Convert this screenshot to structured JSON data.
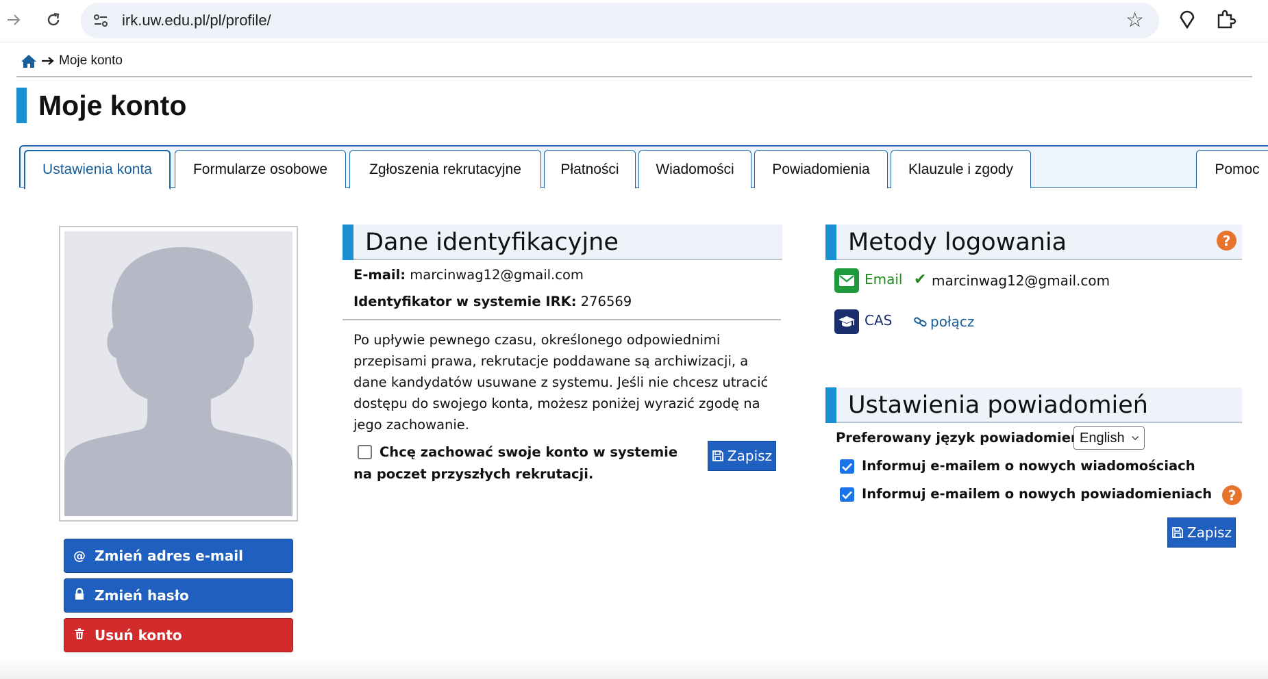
{
  "browser": {
    "url": "irk.uw.edu.pl/pl/profile/"
  },
  "breadcrumb": {
    "current": "Moje konto"
  },
  "page": {
    "title": "Moje konto"
  },
  "tabs": [
    {
      "label": "Ustawienia konta",
      "active": true
    },
    {
      "label": "Formularze osobowe"
    },
    {
      "label": "Zgłoszenia rekrutacyjne"
    },
    {
      "label": "Płatności"
    },
    {
      "label": "Wiadomości"
    },
    {
      "label": "Powiadomienia"
    },
    {
      "label": "Klauzule i zgody"
    },
    {
      "label": "Pomoc"
    }
  ],
  "actions": {
    "change_email": "Zmień adres e-mail",
    "change_password": "Zmień hasło",
    "delete_account": "Usuń konto"
  },
  "identification": {
    "heading": "Dane identyfikacyjne",
    "email_label": "E-mail:",
    "email_value": "marcinwag12@gmail.com",
    "id_label": "Identyfikator w systemie IRK:",
    "id_value": "276569",
    "archive_note": "Po upływie pewnego czasu, określonego odpowiednimi przepisami prawa, rekrutacje poddawane są archiwizacji, a dane kandydatów usuwane z systemu. Jeśli nie chcesz utracić dostępu do swojego konta, możesz poniżej wyrazić zgodę na jego zachowanie.",
    "keep_account_label": "Chcę zachować swoje konto w systemie na poczet przyszłych rekrutacji.",
    "keep_account_checked": false,
    "save_label": "Zapisz"
  },
  "login_methods": {
    "heading": "Metody logowania",
    "email_method": "Email",
    "email_value": "marcinwag12@gmail.com",
    "cas_method": "CAS",
    "cas_connect": "połącz",
    "colors": {
      "email": "#1e8a1e",
      "cas": "#1a2e6e",
      "help": "#e8732c"
    }
  },
  "notification_settings": {
    "heading": "Ustawienia powiadomień",
    "language_label": "Preferowany język powiadomień:",
    "language_value": "English",
    "notify_messages": "Informuj e-mailem o nowych wiadomościach",
    "notify_messages_checked": true,
    "notify_notifications": "Informuj e-mailem o nowych powiadomieniach",
    "notify_notifications_checked": true,
    "save_label": "Zapisz"
  },
  "icons": {
    "help": "?"
  }
}
